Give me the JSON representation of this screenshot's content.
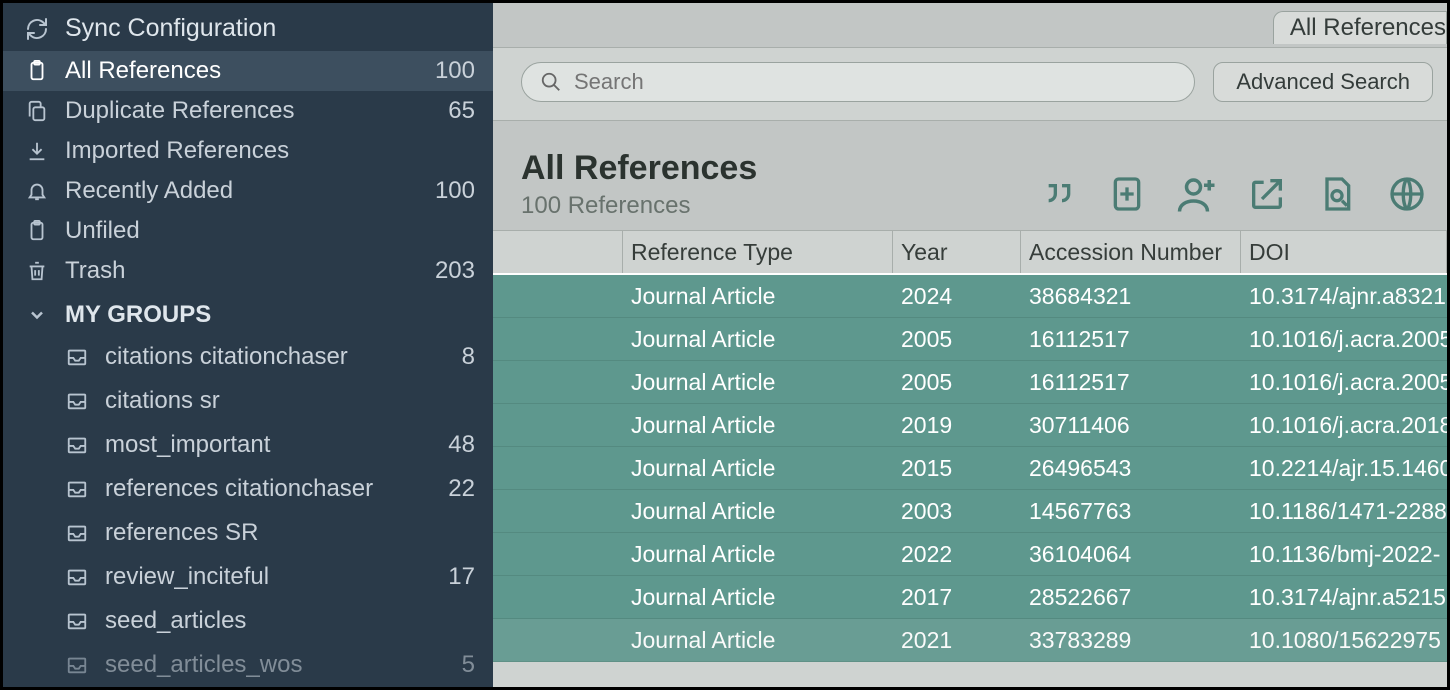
{
  "sidebar": {
    "sync_label": "Sync Configuration",
    "items": [
      {
        "key": "all",
        "label": "All References",
        "count": "100",
        "selected": true
      },
      {
        "key": "dup",
        "label": "Duplicate References",
        "count": "65",
        "selected": false
      },
      {
        "key": "imported",
        "label": "Imported References",
        "count": "",
        "selected": false
      },
      {
        "key": "recent",
        "label": "Recently Added",
        "count": "100",
        "selected": false
      },
      {
        "key": "unfiled",
        "label": "Unfiled",
        "count": "",
        "selected": false
      },
      {
        "key": "trash",
        "label": "Trash",
        "count": "203",
        "selected": false
      }
    ],
    "groups_header": "MY GROUPS",
    "groups": [
      {
        "label": "citations citationchaser",
        "count": "8"
      },
      {
        "label": "citations sr",
        "count": ""
      },
      {
        "label": "most_important",
        "count": "48"
      },
      {
        "label": "references citationchaser",
        "count": "22"
      },
      {
        "label": "references SR",
        "count": ""
      },
      {
        "label": "review_inciteful",
        "count": "17"
      },
      {
        "label": "seed_articles",
        "count": ""
      },
      {
        "label": "seed_articles_wos",
        "count": "5"
      }
    ]
  },
  "topbar": {
    "tab_label": "All References"
  },
  "search": {
    "placeholder": "Search",
    "advanced_label": "Advanced Search"
  },
  "heading": {
    "title": "All References",
    "subtitle": "100 References"
  },
  "table": {
    "columns": [
      "",
      "Reference Type",
      "Year",
      "Accession Number",
      "DOI"
    ],
    "rows": [
      {
        "type": "Journal Article",
        "year": "2024",
        "acc": "38684321",
        "doi": "10.3174/ajnr.a8321"
      },
      {
        "type": "Journal Article",
        "year": "2005",
        "acc": "16112517",
        "doi": "10.1016/j.acra.2005"
      },
      {
        "type": "Journal Article",
        "year": "2005",
        "acc": "16112517",
        "doi": "10.1016/j.acra.2005"
      },
      {
        "type": "Journal Article",
        "year": "2019",
        "acc": "30711406",
        "doi": "10.1016/j.acra.2018"
      },
      {
        "type": "Journal Article",
        "year": "2015",
        "acc": "26496543",
        "doi": "10.2214/ajr.15.1460"
      },
      {
        "type": "Journal Article",
        "year": "2003",
        "acc": "14567763",
        "doi": "10.1186/1471-2288"
      },
      {
        "type": "Journal Article",
        "year": "2022",
        "acc": "36104064",
        "doi": "10.1136/bmj-2022-"
      },
      {
        "type": "Journal Article",
        "year": "2017",
        "acc": "28522667",
        "doi": "10.3174/ajnr.a5215"
      },
      {
        "type": "Journal Article",
        "year": "2021",
        "acc": "33783289",
        "doi": "10.1080/15622975"
      }
    ]
  }
}
